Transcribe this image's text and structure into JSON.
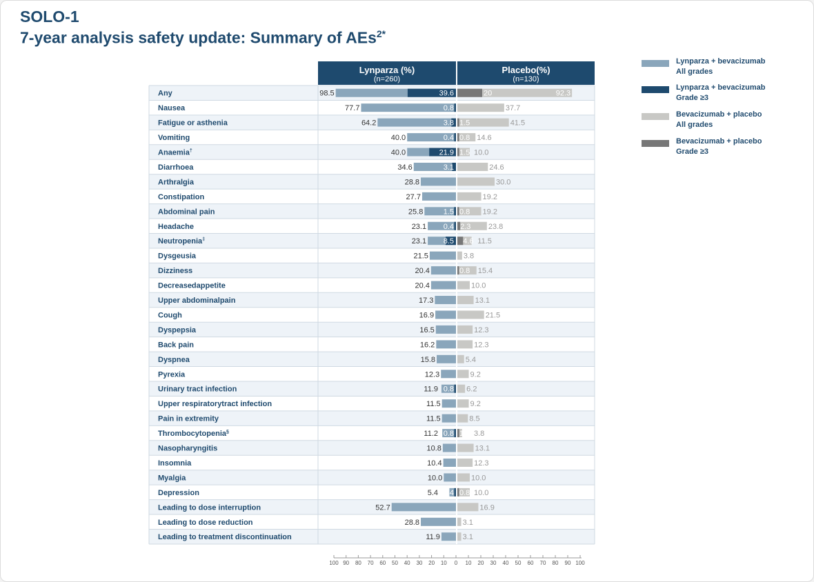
{
  "header": {
    "title": "SOLO-1",
    "subtitle": "7-year analysis safety update: Summary of AEs",
    "subtitle_sup": "2*"
  },
  "columns": {
    "left": {
      "title": "Lynparza (%)",
      "n": "(n=260)"
    },
    "right": {
      "title": "Placebo(%)",
      "n": "(n=130)"
    }
  },
  "legend": [
    {
      "line1": "Lynparza + bevacizumab",
      "line2": "All grades",
      "color": "#8aa6bb"
    },
    {
      "line1": "Lynparza + bevacizumab",
      "line2": "Grade ≥3",
      "color": "#1e4a6e"
    },
    {
      "line1": "Bevacizumab + placebo",
      "line2": "All grades",
      "color": "#c8c8c5"
    },
    {
      "line1": "Bevacizumab + placebo",
      "line2": "Grade ≥3",
      "color": "#777777"
    }
  ],
  "colors": {
    "lyn_all": "#8aa6bb",
    "lyn_g3": "#1e4a6e",
    "pla_all": "#c8c8c5",
    "pla_g3": "#777777",
    "row_alt": "#eef3f8",
    "label": "#1f4a6e"
  },
  "chart_data": {
    "type": "bar",
    "orientation": "horizontal-butterfly",
    "categories": [
      "Any",
      "Nausea",
      "Fatigue or asthenia",
      "Vomiting",
      "Anaemia",
      "Diarrhoea",
      "Arthralgia",
      "Constipation",
      "Abdominal pain",
      "Headache",
      "Neutropenia",
      "Dysgeusia",
      "Dizziness",
      "Decreasedappetite",
      "Upper abdominalpain",
      "Cough",
      "Dyspepsia",
      "Back pain",
      "Dyspnea",
      "Pyrexia",
      "Urinary tract infection",
      "Upper respiratorytract infection",
      "Pain in extremity",
      "Thrombocytopenia",
      "Nasopharyngitis",
      "Insomnia",
      "Myalgia",
      "Depression",
      "Leading to dose interruption",
      "Leading to dose reduction",
      "Leading to treatment discontinuation"
    ],
    "category_superscripts": [
      "",
      "",
      "",
      "",
      "†",
      "",
      "",
      "",
      "",
      "",
      "‡",
      "",
      "",
      "",
      "",
      "",
      "",
      "",
      "",
      "",
      "",
      "",
      "",
      "§",
      "",
      "",
      "",
      "",
      "",
      "",
      ""
    ],
    "series": [
      {
        "name": "Lynparza + bevacizumab All grades",
        "values": [
          98.5,
          77.7,
          64.2,
          40.0,
          40.0,
          34.6,
          28.8,
          27.7,
          25.8,
          23.1,
          23.1,
          21.5,
          20.4,
          20.4,
          17.3,
          16.9,
          16.5,
          16.2,
          15.8,
          12.3,
          11.9,
          11.5,
          11.5,
          11.2,
          10.8,
          10.4,
          10.0,
          5.4,
          52.7,
          28.8,
          11.9
        ],
        "labels": [
          "98.5",
          "77.7",
          "64.2",
          "40.0",
          "40.0",
          "34.6",
          "28.8",
          "27.7",
          "25.8",
          "23.1",
          "23.1",
          "21.5",
          "20.4",
          "20.4",
          "17.3",
          "16.9",
          "16.5",
          "16.2",
          "15.8",
          "12.3",
          "11.9",
          "11.5",
          "11.5",
          "11.2",
          "10.8",
          "10.4",
          "10.0",
          "5.4",
          "52.7",
          "28.8",
          "11.9"
        ]
      },
      {
        "name": "Lynparza + bevacizumab Grade ≥3",
        "values": [
          39.6,
          0.8,
          3.8,
          0.4,
          21.9,
          3.1,
          null,
          null,
          1.5,
          0.4,
          8.5,
          null,
          null,
          null,
          null,
          null,
          null,
          null,
          null,
          null,
          0.8,
          null,
          null,
          0.8,
          null,
          null,
          null,
          0.4,
          null,
          null,
          null
        ],
        "labels": [
          "39.6",
          "0.8",
          "3.8",
          "0.4",
          "21.9",
          "3.1",
          "",
          "",
          "1.5",
          "0.4",
          "8.5",
          "",
          "",
          "",
          "",
          "",
          "",
          "",
          "",
          "",
          "0.8",
          "",
          "",
          "0.8",
          "",
          "",
          "",
          "0.4",
          "",
          "",
          ""
        ]
      },
      {
        "name": "Bevacizumab + placebo All grades",
        "values": [
          92.3,
          37.7,
          41.5,
          14.6,
          10.0,
          24.6,
          30.0,
          19.2,
          19.2,
          23.8,
          11.5,
          3.8,
          15.4,
          10.0,
          13.1,
          21.5,
          12.3,
          12.3,
          5.4,
          9.2,
          6.2,
          9.2,
          8.5,
          3.8,
          13.1,
          12.3,
          10.0,
          10.0,
          16.9,
          3.1,
          3.1
        ],
        "labels": [
          "92.3",
          "37.7",
          "41.5",
          "14.6",
          "10.0",
          "24.6",
          "30.0",
          "19.2",
          "19.2",
          "23.8",
          "11.5",
          "3.8",
          "15.4",
          "10.0",
          "13.1",
          "21.5",
          "12.3",
          "12.3",
          "5.4",
          "9.2",
          "6.2",
          "9.2",
          "8.5",
          "3.8",
          "13.1",
          "12.3",
          "10.0",
          "10.0",
          "16.9",
          "3.1",
          "3.1"
        ]
      },
      {
        "name": "Bevacizumab + placebo Grade ≥3",
        "values": [
          20,
          null,
          1.5,
          0.8,
          1.5,
          null,
          null,
          null,
          0.8,
          2.3,
          4.6,
          null,
          0.8,
          null,
          null,
          null,
          null,
          null,
          null,
          null,
          null,
          null,
          null,
          1.5,
          null,
          null,
          null,
          0.8,
          null,
          null,
          null
        ],
        "labels": [
          "20",
          "",
          "1.5",
          "0.8",
          "1.5",
          "",
          "",
          "",
          "0.8",
          "2.3",
          "4.6",
          "",
          "0.8",
          "",
          "",
          "",
          "",
          "",
          "",
          "",
          "",
          "",
          "",
          "1.5",
          "",
          "",
          "",
          "0.8",
          "",
          "",
          ""
        ]
      }
    ],
    "xlim_left": [
      100,
      0
    ],
    "xlim_right": [
      0,
      100
    ],
    "ticks": [
      "100",
      "90",
      "80",
      "70",
      "60",
      "50",
      "40",
      "30",
      "20",
      "10",
      "0",
      "10",
      "20",
      "30",
      "40",
      "50",
      "60",
      "70",
      "80",
      "90",
      "100"
    ]
  }
}
